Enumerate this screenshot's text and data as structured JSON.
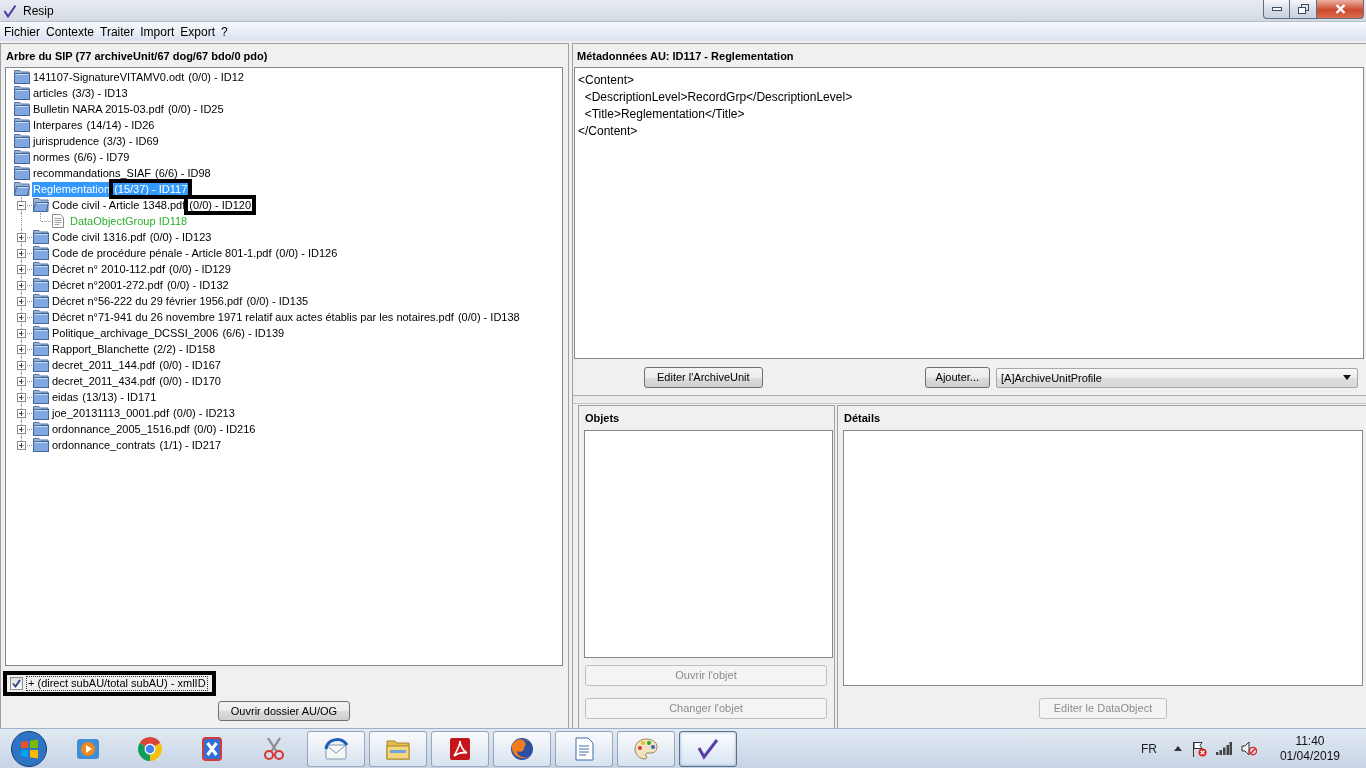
{
  "window": {
    "title": "Resip"
  },
  "menu": [
    "Fichier",
    "Contexte",
    "Traiter",
    "Import",
    "Export",
    "?"
  ],
  "tree": {
    "title": "Arbre du SIP (77 archiveUnit/67 dog/67 bdo/0 pdo)",
    "items": [
      {
        "kind": "folder",
        "name": "141107-SignatureVITAMV0.odt",
        "detail": "(0/0) - ID12",
        "expanded": false,
        "selected": false,
        "highlighted": false
      },
      {
        "kind": "folder",
        "name": "articles",
        "detail": "(3/3) - ID13",
        "expanded": false,
        "selected": false,
        "highlighted": false
      },
      {
        "kind": "folder",
        "name": "Bulletin NARA 2015-03.pdf",
        "detail": "(0/0) - ID25",
        "expanded": false,
        "selected": false,
        "highlighted": false
      },
      {
        "kind": "folder",
        "name": "Interpares",
        "detail": "(14/14) - ID26",
        "expanded": false,
        "selected": false,
        "highlighted": false
      },
      {
        "kind": "folder",
        "name": "jurisprudence",
        "detail": "(3/3) - ID69",
        "expanded": false,
        "selected": false,
        "highlighted": false
      },
      {
        "kind": "folder",
        "name": "normes",
        "detail": "(6/6) - ID79",
        "expanded": false,
        "selected": false,
        "highlighted": false
      },
      {
        "kind": "folder",
        "name": "recommandations_SIAF",
        "detail": "(6/6) - ID98",
        "expanded": false,
        "selected": false,
        "highlighted": false
      },
      {
        "kind": "folder",
        "name": "Reglementation",
        "detail": "(15/37) - ID117",
        "expanded": true,
        "selected": true,
        "highlighted": true,
        "children": [
          {
            "kind": "folder",
            "name": "Code civil - Article 1348.pdf",
            "detail": "(0/0) - ID120",
            "expanded": true,
            "selected": false,
            "highlighted": true,
            "children": [
              {
                "kind": "data_object_group",
                "name": "DataObjectGroup ID118",
                "selected": false,
                "highlighted": false
              }
            ]
          },
          {
            "kind": "folder",
            "name": "Code civil 1316.pdf",
            "detail": "(0/0) - ID123",
            "expanded": false,
            "selected": false,
            "highlighted": false
          },
          {
            "kind": "folder",
            "name": "Code de procédure pénale - Article 801-1.pdf",
            "detail": "(0/0) - ID126",
            "expanded": false,
            "selected": false,
            "highlighted": false
          },
          {
            "kind": "folder",
            "name": "Décret n° 2010-112.pdf",
            "detail": "(0/0) - ID129",
            "expanded": false,
            "selected": false,
            "highlighted": false
          },
          {
            "kind": "folder",
            "name": "Décret n°2001-272.pdf",
            "detail": "(0/0) - ID132",
            "expanded": false,
            "selected": false,
            "highlighted": false
          },
          {
            "kind": "folder",
            "name": "Décret n°56-222 du 29 février 1956.pdf",
            "detail": "(0/0) - ID135",
            "expanded": false,
            "selected": false,
            "highlighted": false
          },
          {
            "kind": "folder",
            "name": "Décret n°71-941 du 26 novembre 1971 relatif aux actes établis par les notaires.pdf",
            "detail": "(0/0) - ID138",
            "expanded": false,
            "selected": false,
            "highlighted": false
          },
          {
            "kind": "folder",
            "name": "Politique_archivage_DCSSI_2006",
            "detail": "(6/6) - ID139",
            "expanded": false,
            "selected": false,
            "highlighted": false
          },
          {
            "kind": "folder",
            "name": "Rapport_Blanchette",
            "detail": "(2/2) - ID158",
            "expanded": false,
            "selected": false,
            "highlighted": false
          },
          {
            "kind": "folder",
            "name": "decret_2011_144.pdf",
            "detail": "(0/0) - ID167",
            "expanded": false,
            "selected": false,
            "highlighted": false
          },
          {
            "kind": "folder",
            "name": "decret_2011_434.pdf",
            "detail": "(0/0) - ID170",
            "expanded": false,
            "selected": false,
            "highlighted": false
          },
          {
            "kind": "folder",
            "name": "eidas",
            "detail": "(13/13) - ID171",
            "expanded": false,
            "selected": false,
            "highlighted": false
          },
          {
            "kind": "folder",
            "name": "joe_20131113_0001.pdf",
            "detail": "(0/0) - ID213",
            "expanded": false,
            "selected": false,
            "highlighted": false
          },
          {
            "kind": "folder",
            "name": "ordonnance_2005_1516.pdf",
            "detail": "(0/0) - ID216",
            "expanded": false,
            "selected": false,
            "highlighted": false
          },
          {
            "kind": "folder",
            "name": "ordonnance_contrats",
            "detail": "(1/1) - ID217",
            "expanded": false,
            "selected": false,
            "highlighted": false
          }
        ]
      }
    ]
  },
  "display_option": {
    "label": "+ (direct subAU/total subAU) - xmlID",
    "checked": true,
    "highlighted": true
  },
  "open_folder_button": {
    "label": "Ouvrir dossier AU/OG",
    "disabled": false
  },
  "metadata": {
    "title": "Métadonnées AU: ID117 - Reglementation",
    "lines": [
      "<Content>",
      "  <DescriptionLevel>RecordGrp</DescriptionLevel>",
      "  <Title>Reglementation</Title>",
      "</Content>"
    ]
  },
  "metadata_actions": {
    "edit_button": {
      "label": "Editer l'ArchiveUnit",
      "disabled": false
    },
    "add_button": {
      "label": "Ajouter...",
      "disabled": false
    },
    "profile_select": {
      "value": "[A]ArchiveUnitProfile"
    }
  },
  "objects": {
    "title": "Objets",
    "buttons": [
      {
        "label": "Ouvrir l'objet",
        "disabled": true
      },
      {
        "label": "Changer l'objet",
        "disabled": true
      }
    ]
  },
  "details": {
    "title": "Détails",
    "button": {
      "label": "Editer le DataObject",
      "disabled": true
    }
  },
  "taskbar": {
    "apps": [
      {
        "kind": "player",
        "running": false,
        "selected": false
      },
      {
        "kind": "ball",
        "running": false,
        "selected": false
      },
      {
        "kind": "cross",
        "running": false,
        "selected": false
      },
      {
        "kind": "scissors",
        "running": false,
        "selected": false
      },
      {
        "kind": "mail",
        "running": true,
        "selected": false
      },
      {
        "kind": "files",
        "running": true,
        "selected": false
      },
      {
        "kind": "swirl",
        "running": true,
        "selected": false
      },
      {
        "kind": "globe",
        "running": true,
        "selected": false
      },
      {
        "kind": "writer",
        "running": true,
        "selected": false
      },
      {
        "kind": "palette",
        "running": true,
        "selected": false
      },
      {
        "kind": "check",
        "running": true,
        "selected": true
      }
    ],
    "language": "FR",
    "time": "11:40",
    "date": "01/04/2019"
  }
}
